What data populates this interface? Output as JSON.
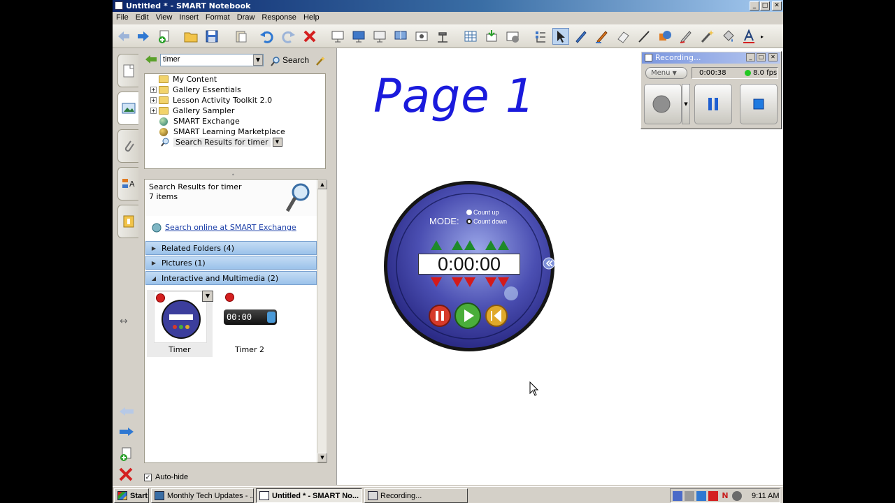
{
  "window": {
    "title": "Untitled * - SMART Notebook",
    "buttons": {
      "minimize": "_",
      "maximize": "□",
      "close": "✕"
    }
  },
  "menu": [
    "File",
    "Edit",
    "View",
    "Insert",
    "Format",
    "Draw",
    "Response",
    "Help"
  ],
  "gallery": {
    "search": {
      "value": "timer",
      "button_label": "Search"
    },
    "tree": [
      {
        "label": "My Content"
      },
      {
        "label": "Gallery Essentials",
        "expand": "+"
      },
      {
        "label": "Lesson Activity Toolkit 2.0",
        "expand": "+"
      },
      {
        "label": "Gallery Sampler",
        "expand": "+"
      },
      {
        "label": "SMART Exchange"
      },
      {
        "label": "SMART Learning Marketplace"
      },
      {
        "label": "Search Results for timer"
      }
    ],
    "results": {
      "heading": "Search Results for timer",
      "count": "7 items",
      "online_link": "Search online at SMART Exchange",
      "categories": [
        {
          "label": "Related Folders (4)",
          "arrow": "▶"
        },
        {
          "label": "Pictures (1)",
          "arrow": "▶"
        },
        {
          "label": "Interactive and Multimedia (2)",
          "arrow": "◢"
        }
      ],
      "items": [
        {
          "caption": "Timer"
        },
        {
          "caption": "Timer 2",
          "display": "00:00"
        }
      ]
    },
    "autohide": {
      "label": "Auto-hide",
      "checked": "✓"
    }
  },
  "canvas": {
    "page_title": "Page 1",
    "timer_widget": {
      "mode_label": "MODE:",
      "options": [
        "Count up",
        "Count down"
      ],
      "selected_option": "Count down",
      "display": "0:00:00"
    }
  },
  "recorder": {
    "title": "Recording...",
    "menu_label": "Menu",
    "elapsed": "0:00:38",
    "fps": "8.0 fps"
  },
  "taskbar": {
    "start_label": "Start",
    "tasks": [
      "Monthly Tech Updates - ...",
      "Untitled * - SMART No...",
      "Recording..."
    ],
    "clock": "9:11 AM"
  },
  "colors": {
    "page_title": "#1a1adc",
    "titlebar": "#0a246a",
    "category": "#9bc2ea"
  }
}
